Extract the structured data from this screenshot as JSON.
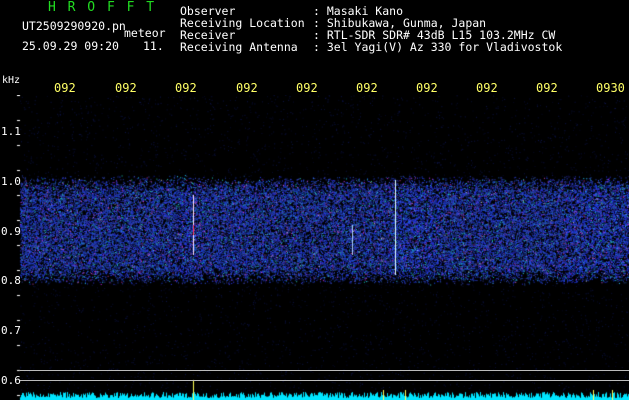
{
  "header": {
    "app_title": "H R O F F T",
    "file_name": "UT2509290920.pn",
    "mode": "meteor",
    "datetime": "25.09.29 09:20",
    "count": "11."
  },
  "info": [
    {
      "label": "Observer",
      "value": ": Masaki Kano"
    },
    {
      "label": "Receiving Location",
      "value": ": Shibukawa, Gunma, Japan"
    },
    {
      "label": "Receiver",
      "value": ": RTL-SDR SDR# 43dB L15 103.2MHz CW"
    },
    {
      "label": "Receiving Antenna",
      "value": ": 3el Yagi(V) Az 330 for Vladivostok"
    }
  ],
  "axis": {
    "unit": "kHz",
    "time_ticks": [
      "092",
      "092",
      "092",
      "092",
      "092",
      "092",
      "092",
      "092",
      "092",
      "0930"
    ],
    "freq_labels": [
      "1.1",
      "1.0",
      "0.9",
      "0.8",
      "0.7",
      "0.6"
    ]
  },
  "colors": {
    "background": "#000000",
    "noise_band": "#2233ee",
    "meteor_trace": "#ffffff",
    "baseline": "#00e5ff",
    "time_ticks": "#ffff66",
    "title": "#22dd22"
  }
}
